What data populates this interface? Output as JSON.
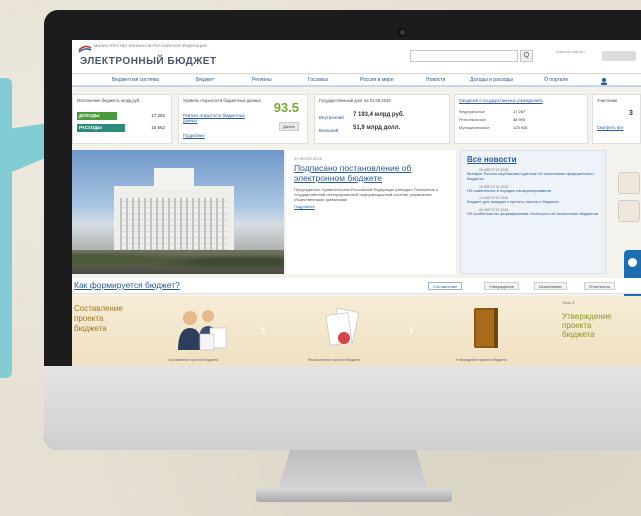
{
  "site": {
    "logo_sub": "МИНИСТЕРСТВО ФИНАНСОВ РОССИЙСКОЙ ФЕДЕРАЦИИ",
    "logo_title": "ЭЛЕКТРОННЫЙ БЮДЖЕТ",
    "search_placeholder": "",
    "search_icon": "Q",
    "login_text": "Единый портал"
  },
  "nav": {
    "items": [
      "Бюджетная система",
      "Бюджет",
      "Регионы",
      "Госзаказ",
      "Россия в мире",
      "Новости",
      "Доходы и расходы",
      "О портале"
    ]
  },
  "widgets": {
    "w1": {
      "title": "Исполнение бюджета, млрд руб.",
      "bar1_label": "ДОХОДЫ",
      "bar1_val": "17 282",
      "bar2_label": "РАСХОДЫ",
      "bar2_val": "15 662"
    },
    "w2": {
      "title": "Уровень открытости бюджетных данных",
      "link1": "Рейтинг открытости бюджетных данных",
      "big": "93.5",
      "btn": "Далее",
      "link2": "Подробнее"
    },
    "w3": {
      "title": "Государственный долг на 01.08.2016",
      "row1_label": "Внутренний",
      "row1_val": "7 193,4 млрд руб.",
      "row2_label": "Внешний",
      "row2_val": "51,9 млрд долл."
    },
    "w4": {
      "title": "Сведения о государственных учреждениях",
      "r1": "Федеральные",
      "r1v": "17 287",
      "r2": "Региональные",
      "r2v": "38 993",
      "r3": "Муниципальные",
      "r3v": "125 926"
    },
    "w5": {
      "title": "Участники",
      "val": "3",
      "link": "Смотреть все"
    }
  },
  "hero": {
    "date": "21 ИЮЛЯ 2016",
    "title": "Подписано постановление об электронном бюджете",
    "body": "Председатель Правительства Российской Федерации утвердил Положение о государственной интегрированной информационной системе управления общественными финансами",
    "more": "Подробнее"
  },
  "news": {
    "title": "Все новости",
    "items": [
      {
        "date": "25 АВГУСТА 2016",
        "text": "Минфин России опубликовал данные об исполнении федерального бюджета"
      },
      {
        "date": "19 АВГУСТА 2016",
        "text": "Об изменениях в порядке санкционирования"
      },
      {
        "date": "12 АВГУСТА 2016",
        "text": "Бюджет для граждан к проекту закона о бюджете"
      },
      {
        "date": "05 АВГУСТА 2016",
        "text": "Об особенностях формирования отчетности об исполнении бюджетов"
      }
    ]
  },
  "section": {
    "title": "Как формируется бюджет?",
    "tabs": [
      "Составление",
      "Утверждение",
      "Исполнение",
      "Отчетность"
    ]
  },
  "process": {
    "left_text": [
      "Составление",
      "проекта",
      "бюджета"
    ],
    "step_label": "Этап 3",
    "right_text": [
      "Утверждение",
      "проекта",
      "бюджета"
    ],
    "captions": [
      "Составление проекта бюджета",
      "Рассмотрение проекта бюджета",
      "Утверждение проекта бюджета"
    ]
  }
}
